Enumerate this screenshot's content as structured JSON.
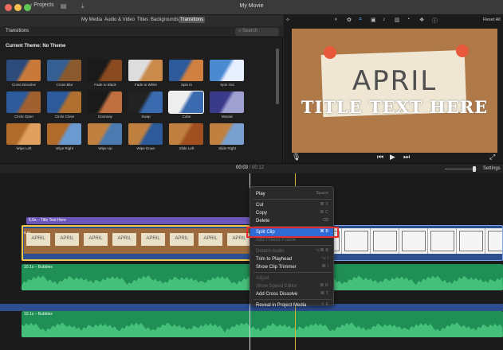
{
  "window": {
    "title": "My Movie",
    "back_label": "Projects"
  },
  "browser": {
    "tabs": [
      {
        "label": "My Media",
        "active": false
      },
      {
        "label": "Audio & Video",
        "active": false
      },
      {
        "label": "Titles",
        "active": false
      },
      {
        "label": "Backgrounds",
        "active": false
      },
      {
        "label": "Transitions",
        "active": true
      }
    ],
    "panel_title": "Transitions",
    "search_placeholder": "Search",
    "theme_label": "Current Theme: No Theme",
    "transitions": [
      "Cross Dissolve",
      "Cross Blur",
      "Fade to Black",
      "Fade to White",
      "Spin In",
      "Spin Out",
      "Circle Open",
      "Circle Close",
      "Doorway",
      "Swap",
      "Cube",
      "Mosaic",
      "Wipe Left",
      "Wipe Right",
      "Wipe Up",
      "Wipe Down",
      "Slide Left",
      "Slide Right"
    ],
    "selected_transition": "Cube"
  },
  "viewer": {
    "reset_all": "Reset All",
    "title_line1": "APRIL",
    "title_line2": "TITLE TEXT HERE"
  },
  "timeline": {
    "current_time": "00:03",
    "total_time": "00:12",
    "settings_label": "Settings",
    "title_clip_label": "6.0s – Title Text Here",
    "video_clip_duration": "6.0s",
    "frame_text": "APRIL",
    "audio_clips": [
      {
        "label": "10.1s – Bubbles"
      },
      {
        "label": "10.1s – Bubbles"
      }
    ]
  },
  "context_menu": {
    "items": [
      {
        "label": "Play",
        "shortcut": "Space",
        "disabled": false,
        "highlighted": false
      },
      {
        "separator": true
      },
      {
        "label": "Cut",
        "shortcut": "⌘ X",
        "disabled": false,
        "highlighted": false
      },
      {
        "label": "Copy",
        "shortcut": "⌘ C",
        "disabled": false,
        "highlighted": false
      },
      {
        "label": "Delete",
        "shortcut": "⌫",
        "disabled": false,
        "highlighted": false
      },
      {
        "separator": true
      },
      {
        "label": "Split Clip",
        "shortcut": "⌘ B",
        "disabled": false,
        "highlighted": true
      },
      {
        "label": "Add Freeze Frame",
        "shortcut": "",
        "disabled": true,
        "highlighted": false
      },
      {
        "separator": true
      },
      {
        "label": "Detach Audio",
        "shortcut": "⌥⌘ B",
        "disabled": true,
        "highlighted": false
      },
      {
        "label": "Trim to Playhead",
        "shortcut": "⌥ /",
        "disabled": false,
        "highlighted": false
      },
      {
        "label": "Show Clip Trimmer",
        "shortcut": "⌘ \\",
        "disabled": false,
        "highlighted": false
      },
      {
        "separator": true
      },
      {
        "label": "Adjust",
        "shortcut": "",
        "disabled": true,
        "highlighted": false
      },
      {
        "label": "Show Speed Editor",
        "shortcut": "⌘ R",
        "disabled": true,
        "highlighted": false
      },
      {
        "label": "Add Cross Dissolve",
        "shortcut": "⌘ T",
        "disabled": false,
        "highlighted": false
      },
      {
        "separator": true
      },
      {
        "label": "Reveal in Project Media",
        "shortcut": "⇧ F",
        "disabled": false,
        "highlighted": false
      }
    ]
  },
  "colors": {
    "accent": "#2f6bd6",
    "title_clip": "#6b57b9",
    "audio_clip": "#1f8f55",
    "video_track": "#2d4e8f",
    "annotation_red": "#e52b2b"
  }
}
